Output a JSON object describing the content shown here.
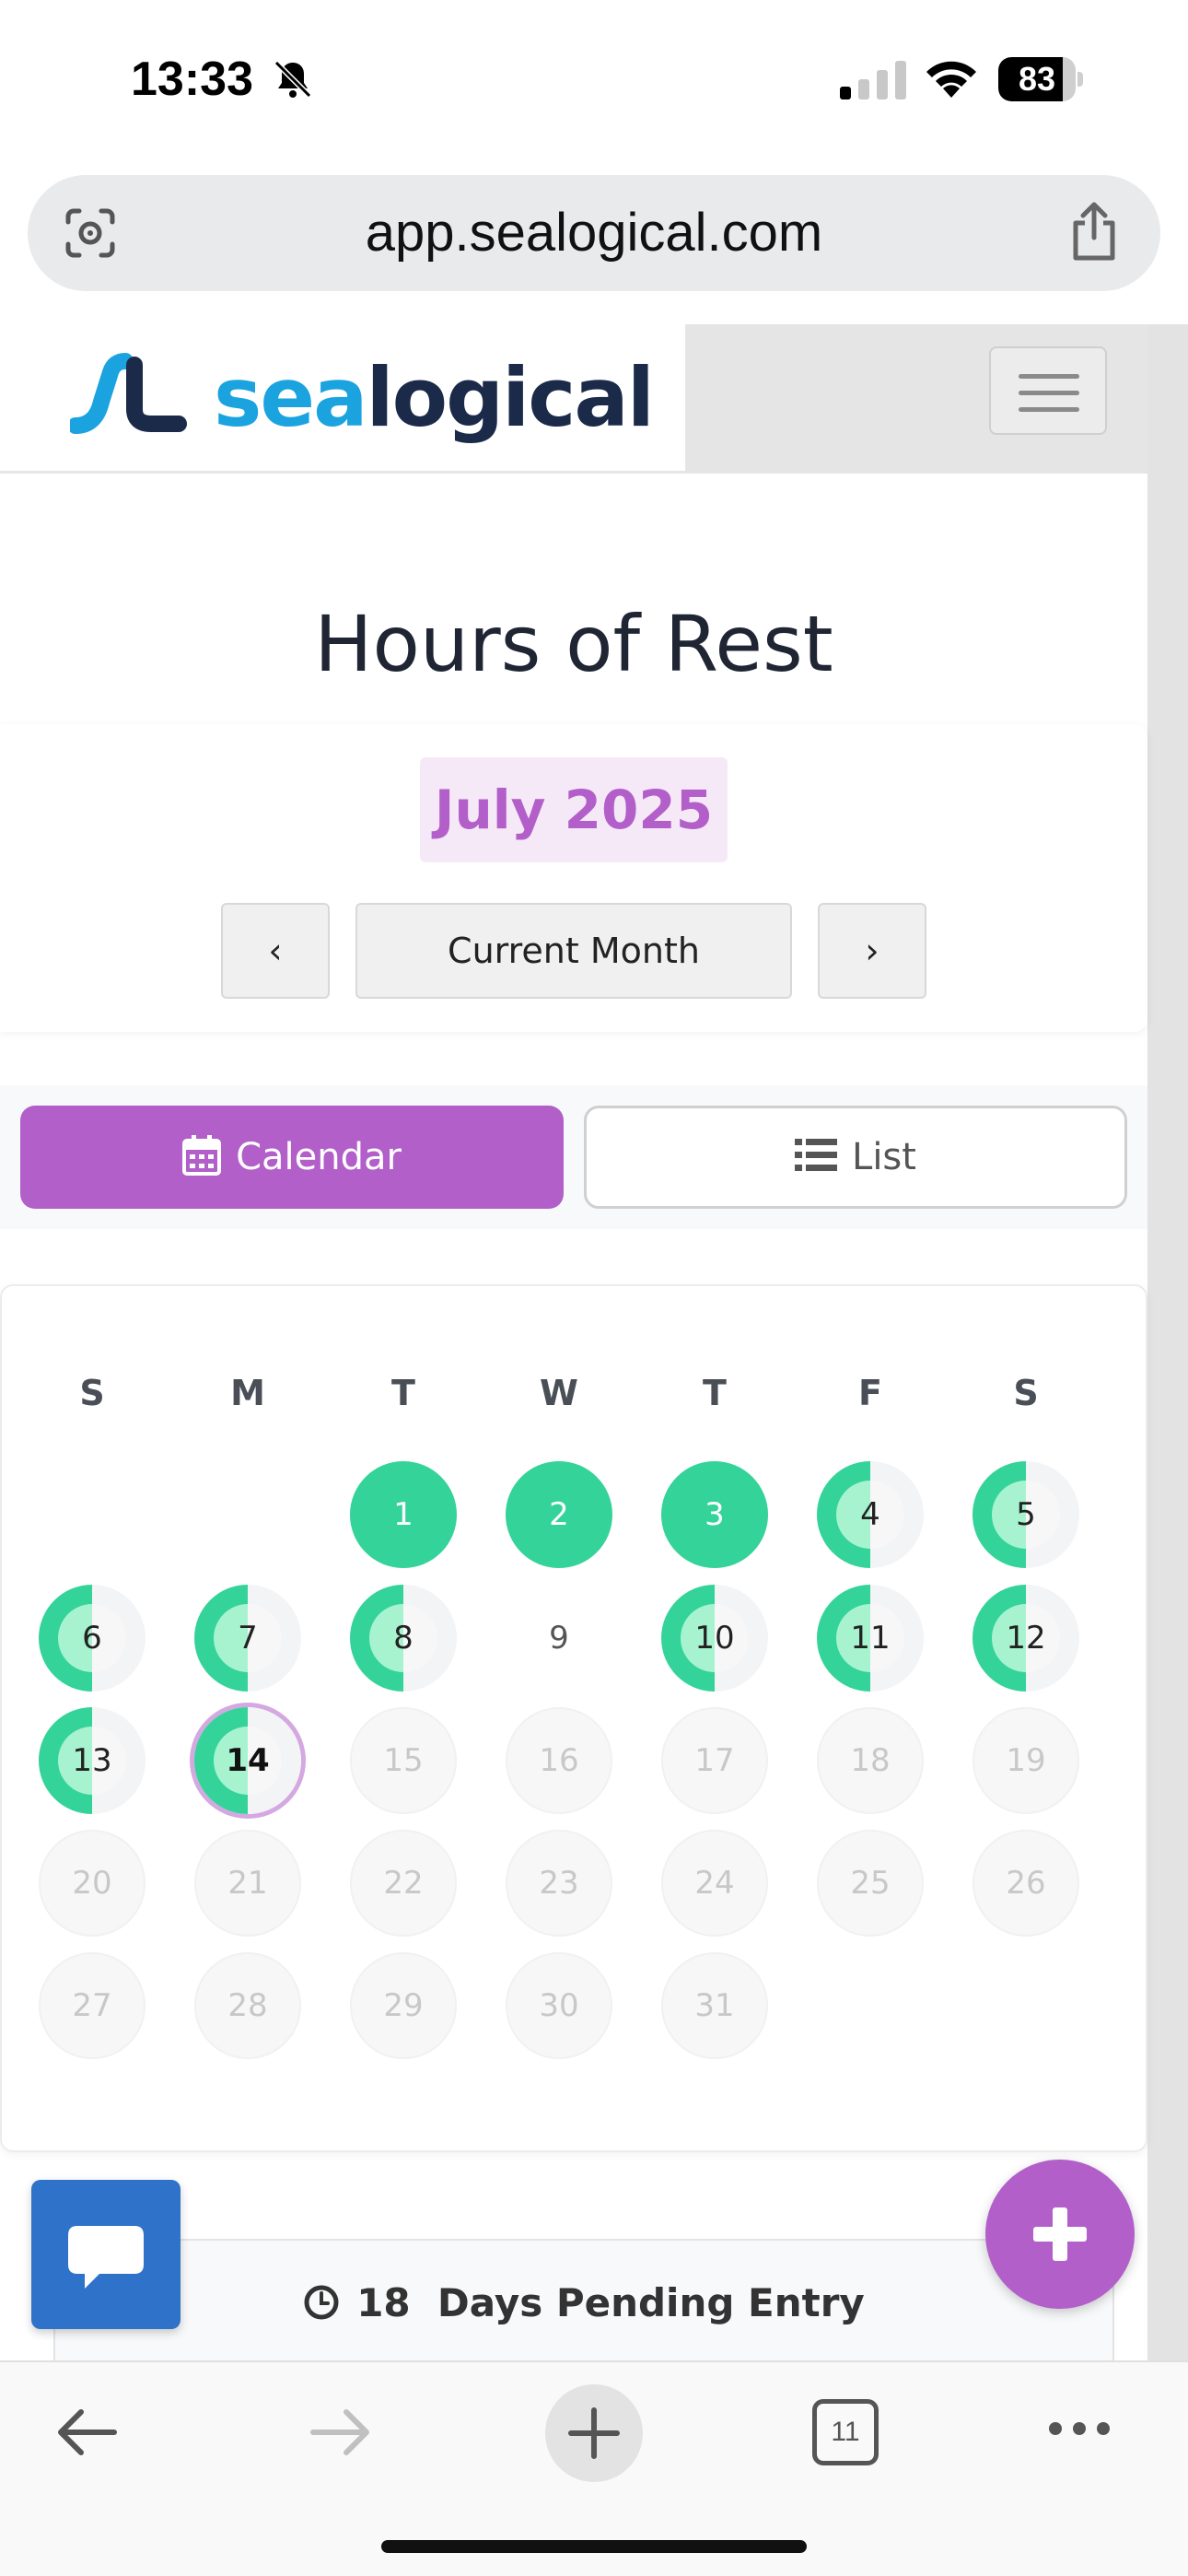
{
  "status_bar": {
    "time": "13:33",
    "battery_level": "83",
    "battery_fraction": 0.83,
    "icons": [
      "bell-muted-icon",
      "cellular-signal-icon",
      "wifi-icon",
      "battery-icon"
    ]
  },
  "browser": {
    "url": "app.sealogical.com",
    "icons": [
      "visual-search-icon",
      "share-icon"
    ],
    "toolbar": {
      "tab_count": "11",
      "icons": [
        "back-arrow-icon",
        "forward-arrow-icon",
        "new-tab-icon",
        "tabs-icon",
        "more-icon"
      ]
    }
  },
  "header": {
    "logo_part1": "sea",
    "logo_part2": "logical",
    "menu_icon": "hamburger-menu-icon"
  },
  "page": {
    "title": "Hours of Rest",
    "month_label": "July 2025",
    "prev_label": "‹",
    "current_label": "Current Month",
    "next_label": "›"
  },
  "view_toggle": {
    "calendar_label": "Calendar",
    "list_label": "List",
    "calendar_icon": "calendar-icon",
    "list_icon": "list-icon",
    "active": "Calendar"
  },
  "calendar": {
    "weekdays": [
      "S",
      "M",
      "T",
      "W",
      "T",
      "F",
      "S"
    ],
    "first_weekday_index": 2,
    "today": 14,
    "colors": {
      "complete": "#34d399",
      "partial_inner": "#a7f3d0",
      "accent": "#b25fca"
    },
    "days": [
      {
        "day": "1",
        "status": "full"
      },
      {
        "day": "2",
        "status": "full"
      },
      {
        "day": "3",
        "status": "full"
      },
      {
        "day": "4",
        "status": "half"
      },
      {
        "day": "5",
        "status": "half"
      },
      {
        "day": "6",
        "status": "half"
      },
      {
        "day": "7",
        "status": "half"
      },
      {
        "day": "8",
        "status": "half"
      },
      {
        "day": "9",
        "status": "none"
      },
      {
        "day": "10",
        "status": "half"
      },
      {
        "day": "11",
        "status": "half"
      },
      {
        "day": "12",
        "status": "half"
      },
      {
        "day": "13",
        "status": "half"
      },
      {
        "day": "14",
        "status": "half"
      },
      {
        "day": "15",
        "status": "future"
      },
      {
        "day": "16",
        "status": "future"
      },
      {
        "day": "17",
        "status": "future"
      },
      {
        "day": "18",
        "status": "future"
      },
      {
        "day": "19",
        "status": "future"
      },
      {
        "day": "20",
        "status": "future"
      },
      {
        "day": "21",
        "status": "future"
      },
      {
        "day": "22",
        "status": "future"
      },
      {
        "day": "23",
        "status": "future"
      },
      {
        "day": "24",
        "status": "future"
      },
      {
        "day": "25",
        "status": "future"
      },
      {
        "day": "26",
        "status": "future"
      },
      {
        "day": "27",
        "status": "future"
      },
      {
        "day": "28",
        "status": "future"
      },
      {
        "day": "29",
        "status": "future"
      },
      {
        "day": "30",
        "status": "future"
      },
      {
        "day": "31",
        "status": "future"
      }
    ]
  },
  "pending": {
    "count": "18",
    "label": "Days Pending Entry",
    "icon": "clock-icon"
  },
  "floating": {
    "chat_icon": "chat-bubble-icon",
    "add_icon": "plus-icon"
  }
}
